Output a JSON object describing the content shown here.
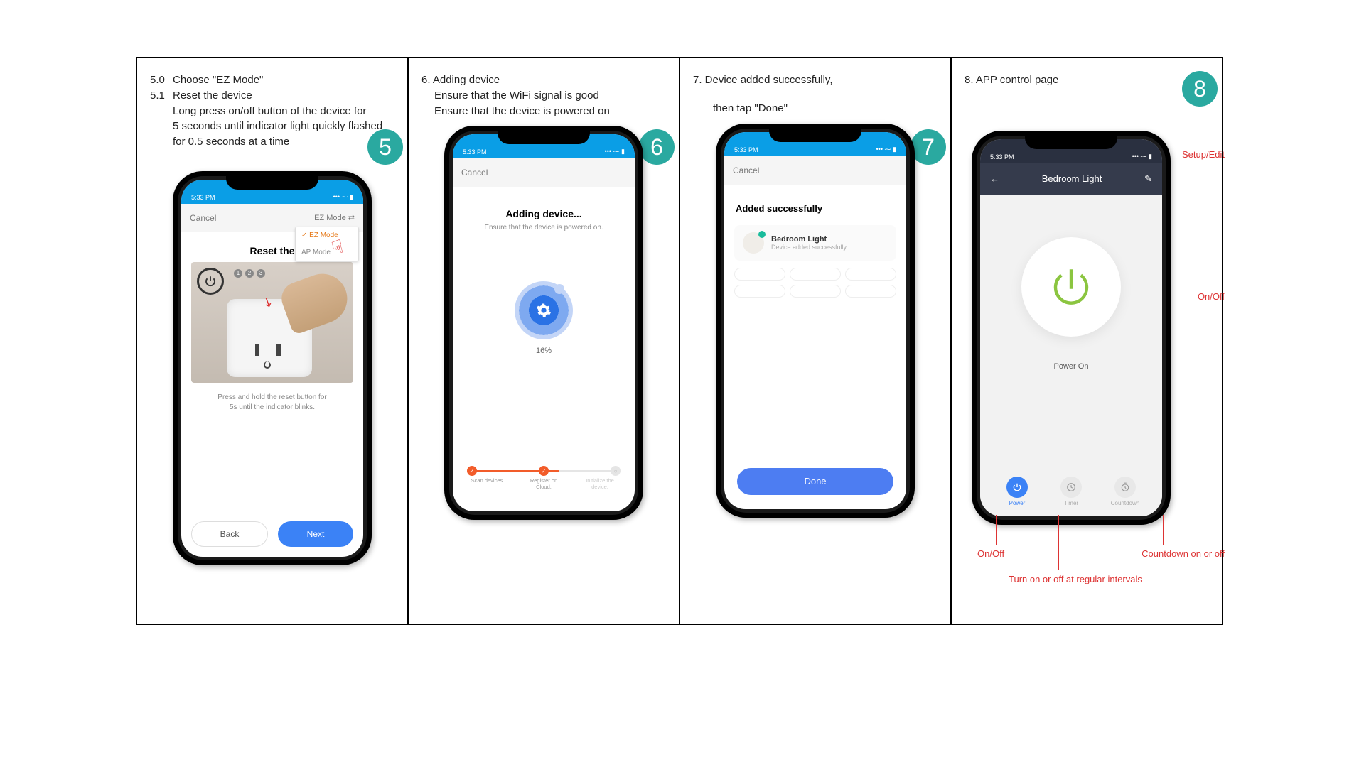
{
  "panels": {
    "p5": {
      "badge": "5",
      "l1_num": "5.0",
      "l1_txt": "Choose  \"EZ Mode\"",
      "l2_num": "5.1",
      "l2_txt": "Reset  the  device",
      "l3": "Long press on/off button of the device for",
      "l4": "5 seconds until indicator light quickly flashed",
      "l5": "for 0.5 seconds at a time"
    },
    "p6": {
      "badge": "6",
      "l1": "6. Adding  device",
      "l2": "Ensure that the WiFi signal is good",
      "l3": "Ensure that the device is powered on"
    },
    "p7": {
      "badge": "7",
      "l1": "7. Device added successfully,",
      "l2": "then tap \"Done\""
    },
    "p8": {
      "badge": "8",
      "l1": "8. APP  control page",
      "co_edit": "Setup/Edit",
      "co_onoff_big": "On/Off",
      "co_onoff": "On/Off",
      "co_cd": "Countdown on or off",
      "co_timer": "Turn on or off at regular intervals"
    }
  },
  "phone": {
    "status_time": "5:33 PM",
    "cancel": "Cancel",
    "ez_label": "EZ Mode",
    "mode1": "EZ Mode",
    "mode2": "AP Mode"
  },
  "screen5": {
    "title": "Reset the",
    "caption1": "Press and hold the reset button for",
    "caption2": "5s until the indicator blinks.",
    "back": "Back",
    "next": "Next"
  },
  "screen6": {
    "title": "Adding device...",
    "sub": "Ensure that the device is powered on.",
    "pct": "16%",
    "r1": "Scan devices.",
    "r2": "Register on Cloud.",
    "r3": "Initialize the device."
  },
  "screen7": {
    "title": "Added successfully",
    "dev_name": "Bedroom Light",
    "dev_status": "Device added successfully",
    "done": "Done"
  },
  "screen8": {
    "title": "Bedroom Light",
    "power_label": "Power On",
    "tab1": "Power",
    "tab2": "Timer",
    "tab3": "Countdown"
  }
}
